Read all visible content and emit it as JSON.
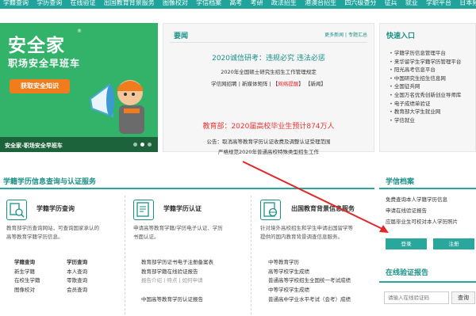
{
  "topnav": [
    "学籍查询",
    "学历查询",
    "在线验证",
    "出国教育背景服务",
    "图像校对",
    "学信档案",
    "高考",
    "考研",
    "政法招生",
    "港澳台招生",
    "四六级查分",
    "征兵",
    "就业",
    "学职平台",
    "日本频道"
  ],
  "banner": {
    "logo": "安全家",
    "reg": "®",
    "slogan": "职场安全早班车",
    "cta": "获取安全知识",
    "caption": "安全家-职场安全早班车"
  },
  "news": {
    "title": "要闻",
    "more": "更多新闻",
    "topics": "专题汇总",
    "headline1": "2020诚信研考：违规必究 违法必惩",
    "item1": "2020年全国硕士研究生招生工作管理规定",
    "item2_a": "学信网招聘",
    "item2_b": "新媒体矩阵",
    "item2_c": "网络提醒",
    "item2_d": "新闻",
    "headline2": "教育部：2020届高校毕业生预计874万人",
    "item3": "公告：取消高等教育学历认证收费及调整认证受理范围",
    "item4": "严格规范2020年普通高校特殊类型招生工作"
  },
  "quick": {
    "title": "快速入口",
    "items": [
      "学籍学历信息管理平台",
      "来华留学生学籍学历管理平台",
      "阳光高考信息平台",
      "中国研究生招生信息网",
      "全国征兵网",
      "全国万名优秀创新创业导师库",
      "电子成绩单验证",
      "教育部大学生就业网",
      "学信就业"
    ]
  },
  "section": {
    "title": "学籍学历信息查询与认证服务"
  },
  "card1": {
    "title": "学籍学历查询",
    "desc1": "教育部学历查询网站，可查询国家承认的",
    "desc2": "高等教育学籍学历信息。",
    "links": [
      [
        "学籍查询",
        "学历查询"
      ],
      [
        "新生学籍",
        "本人查询"
      ],
      [
        "在校生学籍",
        "零散查询"
      ],
      [
        "图像校对",
        "会员查询"
      ]
    ]
  },
  "card2": {
    "title": "学籍学历认证",
    "desc1": "申请高等教育学籍/学历电子认证、学历",
    "desc2": "书面认证。",
    "link1": "教育部学历证书电子注册备案表",
    "link2": "教育部学籍在线验证报告",
    "sub": "报告介绍 | 特点 | 如何申请",
    "link3": "中国高等教育学历认证报告"
  },
  "card3": {
    "title": "出国教育背景信息服务",
    "desc1": "针对境外高校招生和学生申请出国留学等",
    "desc2": "提供的国内教育背景调查信息服务。",
    "links": [
      "中等教育学历",
      "高等学校学生成绩",
      "普通高等学校招生全国统一考试成绩",
      "中等学校学生成绩",
      "普通高中学业水平考试（会考）成绩"
    ]
  },
  "archive": {
    "title": "学信档案",
    "items": [
      "免费查询本人学籍学历信息",
      "申请在线验证报告",
      "应届毕业生可校对本人学历照片"
    ],
    "login": "登录",
    "register": "注册"
  },
  "verify": {
    "title": "在线验证报告",
    "placeholder": "请输入在线验证码",
    "button": "查询"
  }
}
